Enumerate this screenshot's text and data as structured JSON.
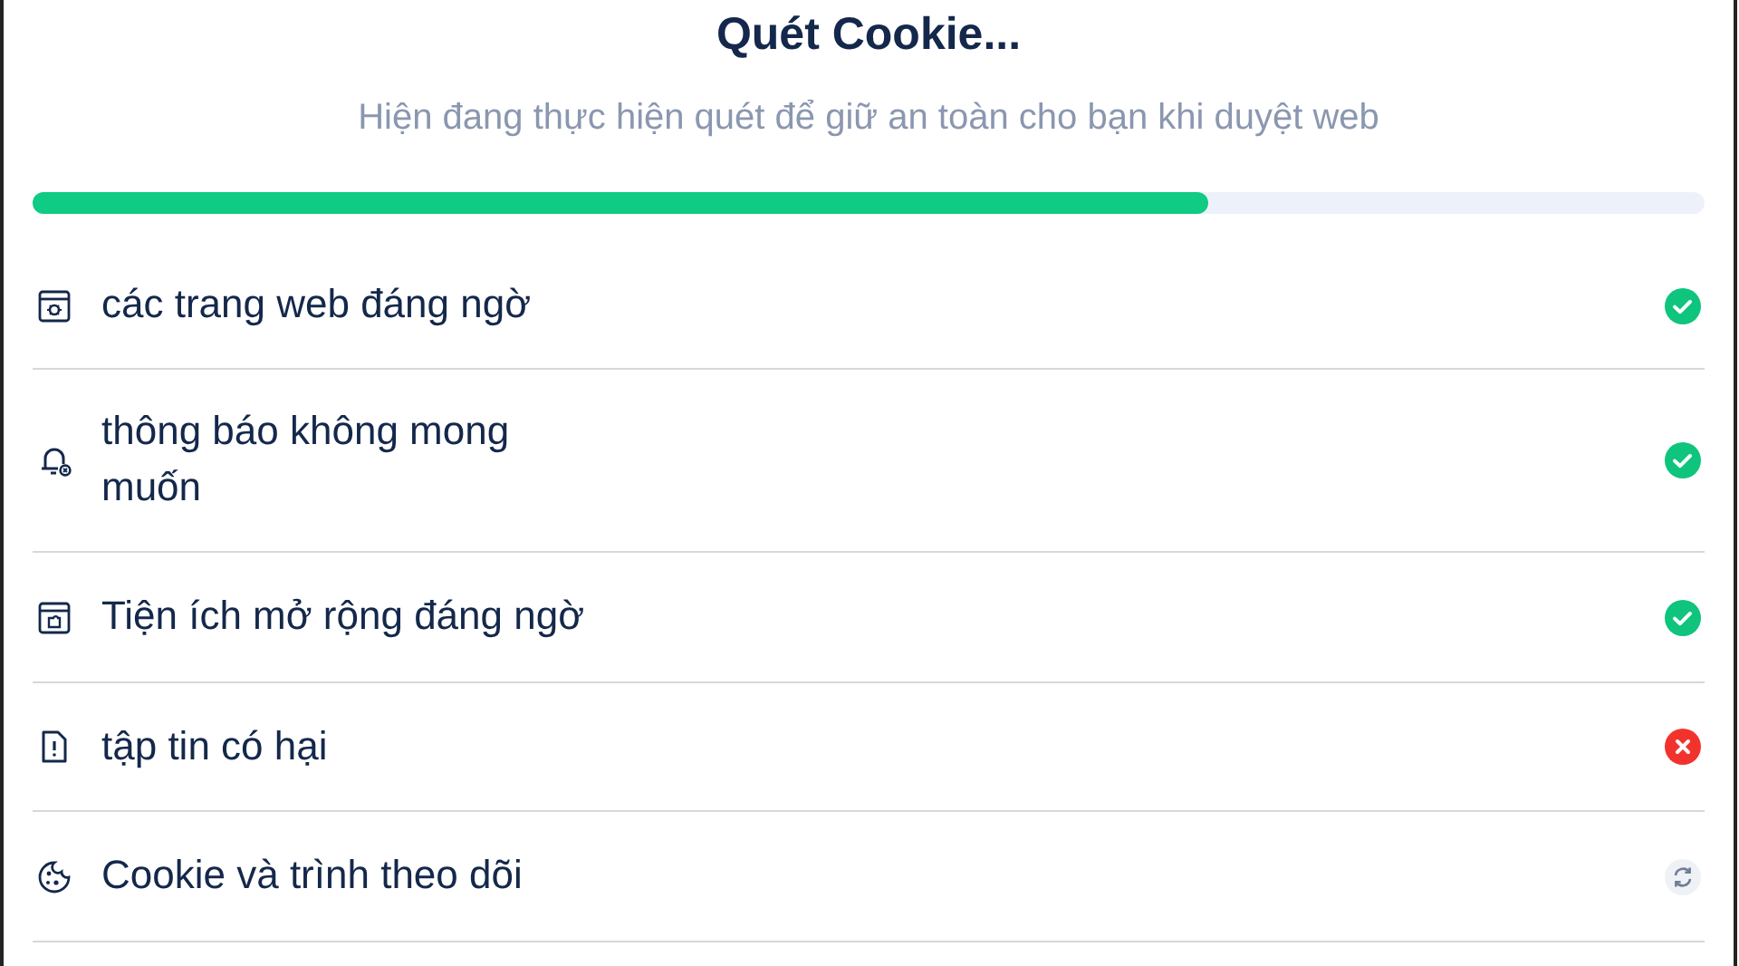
{
  "title": "Quét Cookie...",
  "subtitle": "Hiện đang thực hiện quét để giữ an toàn cho bạn khi duyệt web",
  "progress": {
    "level": 0.703
  },
  "items": [
    {
      "label": "các trang web đáng ngờ",
      "done": true,
      "passed": true
    },
    {
      "label": "thông báo không mong muốn",
      "done": true,
      "passed": true
    },
    {
      "label": "Tiện ích mở rộng đáng ngờ",
      "done": true,
      "passed": true
    },
    {
      "label": "tập tin có hại",
      "done": true,
      "passed": false
    },
    {
      "label": "Cookie và trình theo dõi",
      "done": false
    }
  ]
}
